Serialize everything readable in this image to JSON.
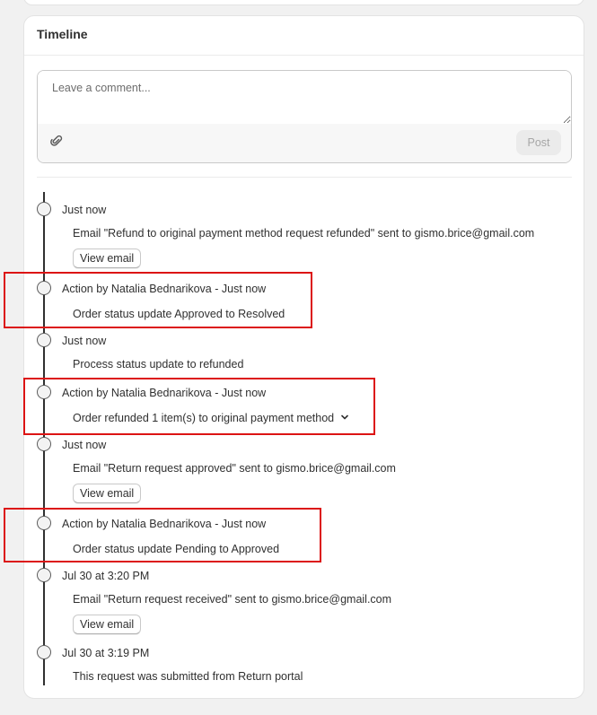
{
  "card": {
    "title": "Timeline"
  },
  "comment": {
    "placeholder": "Leave a comment...",
    "post_label": "Post"
  },
  "events": [
    {
      "time": "Just now",
      "detail": "Email \"Refund to original payment method request refunded\" sent to gismo.brice@gmail.com",
      "button": "View email"
    },
    {
      "time": "Action by Natalia Bednarikova - Just now",
      "detail": "Order status update Approved to Resolved"
    },
    {
      "time": "Just now",
      "detail": "Process status update to refunded"
    },
    {
      "time": "Action by Natalia Bednarikova - Just now",
      "detail": "Order refunded 1 item(s) to original payment method"
    },
    {
      "time": "Just now",
      "detail": "Email \"Return request approved\" sent to gismo.brice@gmail.com",
      "button": "View email"
    },
    {
      "time": "Action by Natalia Bednarikova - Just now",
      "detail": "Order status update Pending to Approved"
    },
    {
      "time": "Jul 30 at 3:20 PM",
      "detail": "Email \"Return request received\" sent to gismo.brice@gmail.com",
      "button": "View email"
    },
    {
      "time": "Jul 30 at 3:19 PM",
      "detail": "This request was submitted from Return portal"
    }
  ],
  "colors": {
    "highlight": "#dc1414",
    "post_disabled_bg": "#ebebeb",
    "post_disabled_text": "#a6a6a6"
  },
  "icons": {
    "attach": "paperclip-icon",
    "expand": "chevron-down-icon"
  }
}
